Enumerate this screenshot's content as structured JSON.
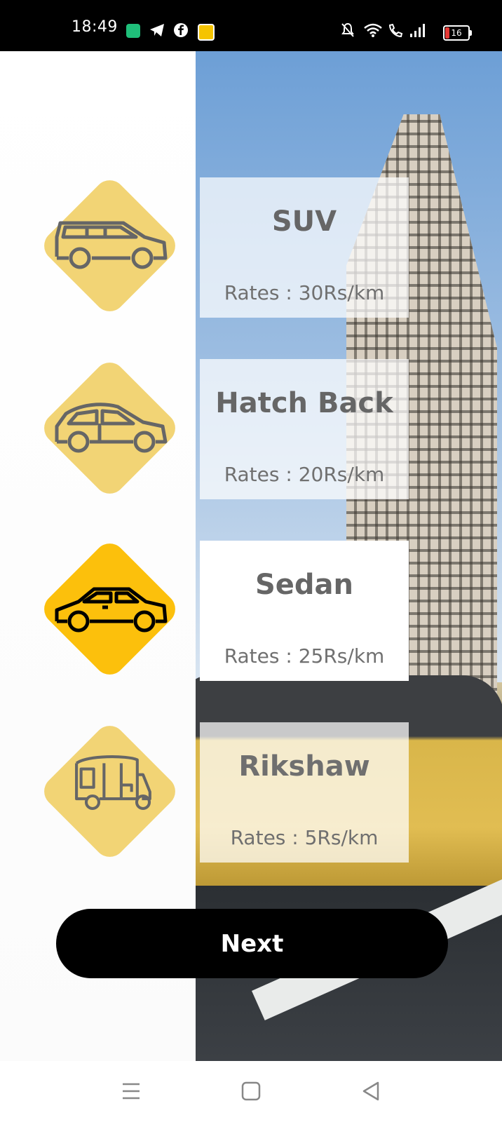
{
  "status_bar": {
    "time": "18:49",
    "battery": "16",
    "battery_color": "#e53935"
  },
  "vehicles": [
    {
      "name": "SUV",
      "rate": "Rates : 30Rs/km",
      "icon": "suv-icon",
      "selected": false
    },
    {
      "name": "Hatch Back",
      "rate": "Rates : 20Rs/km",
      "icon": "hatchback-icon",
      "selected": false
    },
    {
      "name": "Sedan",
      "rate": "Rates : 25Rs/km",
      "icon": "sedan-icon",
      "selected": true
    },
    {
      "name": "Rikshaw",
      "rate": "Rates : 5Rs/km",
      "icon": "rikshaw-icon",
      "selected": false
    }
  ],
  "next_button": {
    "label": "Next"
  },
  "colors": {
    "accent_active": "#fcc00c",
    "accent_inactive": "#f2d475",
    "button_bg": "#000000"
  },
  "nav_bar": {
    "icons": [
      "menu-icon",
      "home-icon",
      "back-icon"
    ]
  }
}
